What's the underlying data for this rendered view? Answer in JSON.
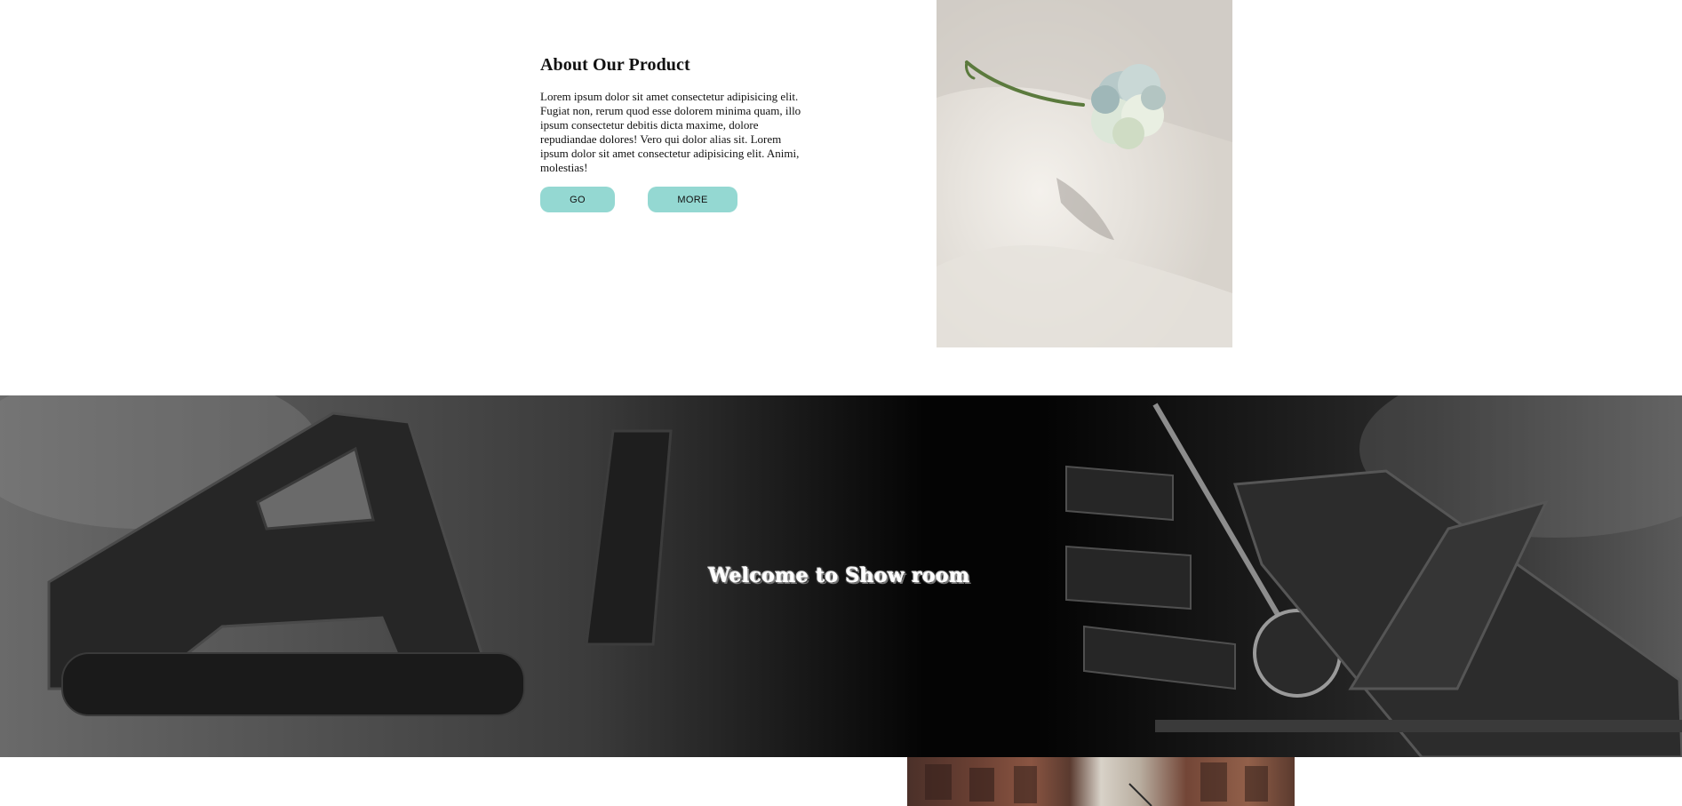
{
  "about": {
    "title": "About Our Product",
    "body": "Lorem ipsum dolor sit amet consectetur adipisicing elit. Fugiat non, rerum quod esse dolorem minima quam, illo ipsum consectetur debitis dicta maxime, dolore repudiandae dolores! Vero qui dolor alias sit. Lorem ipsum dolor sit amet consectetur adipisicing elit. Animi, molestias!",
    "go_label": "GO",
    "more_label": "MORE"
  },
  "banner": {
    "title": "Welcome to Show room"
  },
  "colors": {
    "button_bg": "#94d8d2",
    "banner_bg": "#050505",
    "text": "#111111"
  }
}
